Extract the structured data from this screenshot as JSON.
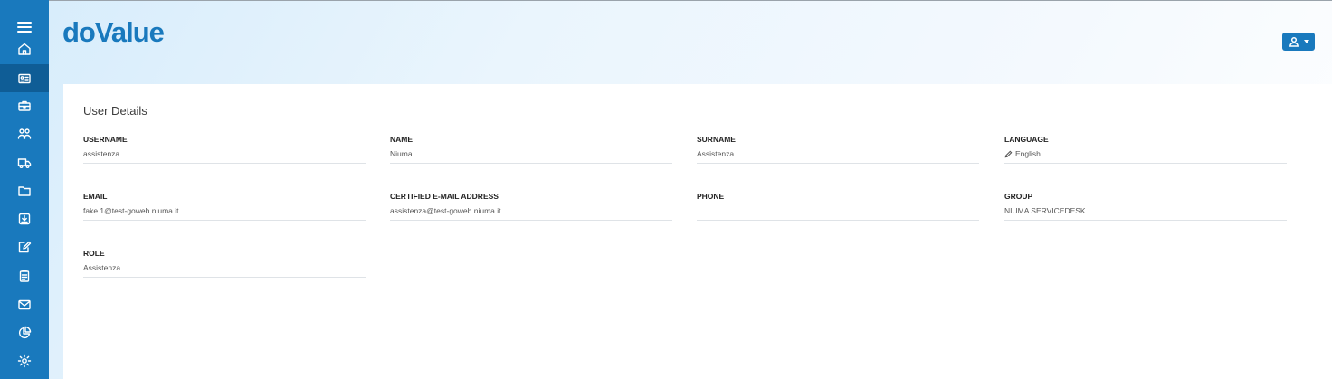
{
  "app": {
    "logo_text": "doValue",
    "brand_color": "#1979bd"
  },
  "sidebar": {
    "items": [
      {
        "icon": "menu-icon"
      },
      {
        "icon": "home-icon"
      },
      {
        "icon": "id-card-icon",
        "active": true
      },
      {
        "icon": "briefcase-icon"
      },
      {
        "icon": "users-icon"
      },
      {
        "icon": "truck-icon"
      },
      {
        "icon": "folder-icon"
      },
      {
        "icon": "download-box-icon"
      },
      {
        "icon": "edit-document-icon"
      },
      {
        "icon": "clipboard-icon"
      },
      {
        "icon": "mail-icon"
      },
      {
        "icon": "pie-chart-icon"
      },
      {
        "icon": "gear-icon"
      }
    ]
  },
  "header": {
    "user_button_icon": "user-icon"
  },
  "user_details": {
    "title": "User Details",
    "fields": {
      "username": {
        "label": "USERNAME",
        "value": "assistenza"
      },
      "name": {
        "label": "NAME",
        "value": "Niuma"
      },
      "surname": {
        "label": "SURNAME",
        "value": "Assistenza"
      },
      "language": {
        "label": "LANGUAGE",
        "value": "English",
        "icon": "pencil-icon"
      },
      "email": {
        "label": "EMAIL",
        "value": "fake.1@test-goweb.niuma.it"
      },
      "certified_email": {
        "label": "CERTIFIED E-MAIL ADDRESS",
        "value": "assistenza@test-goweb.niuma.it"
      },
      "phone": {
        "label": "PHONE",
        "value": ""
      },
      "group": {
        "label": "GROUP",
        "value": "NIUMA SERVICEDESK"
      },
      "role": {
        "label": "ROLE",
        "value": "Assistenza"
      }
    }
  }
}
